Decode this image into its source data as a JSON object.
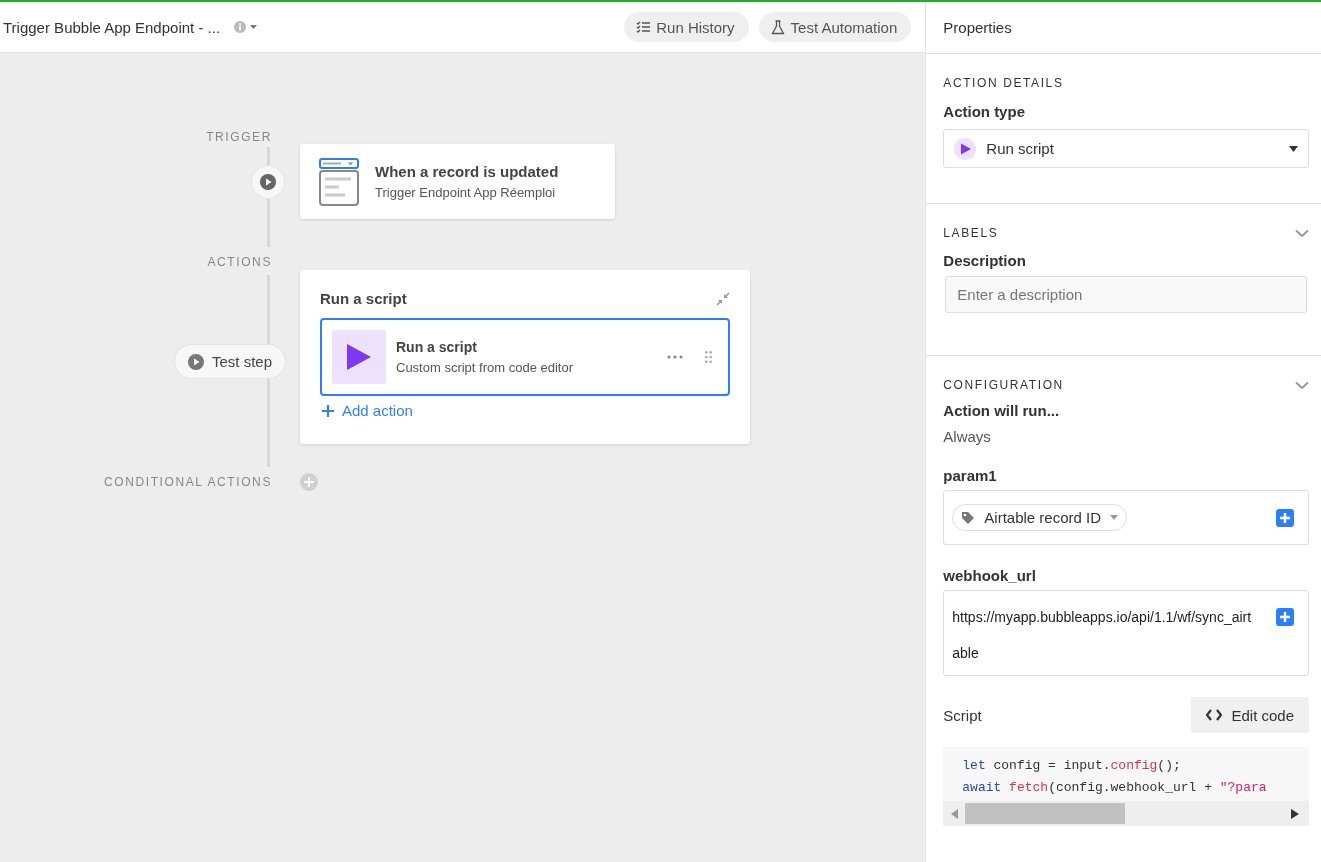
{
  "header": {
    "title": "Trigger Bubble App Endpoint - ...",
    "buttons": [
      {
        "label": "Run History",
        "kind": "history"
      },
      {
        "label": "Test Automation",
        "kind": "test"
      }
    ]
  },
  "flow": {
    "trigger_label": "TRIGGER",
    "trigger": {
      "title": "When a record is updated",
      "subtitle": "Trigger Endpoint App Réemploi"
    },
    "actions_label": "ACTIONS",
    "test_step": "Test step",
    "group": {
      "title": "Run a script",
      "actions": [
        {
          "title": "Run a script",
          "subtitle": "Custom script from code editor",
          "selected": true
        }
      ],
      "add_action": "Add action"
    },
    "conditional_label": "CONDITIONAL ACTIONS"
  },
  "properties": {
    "title": "Properties",
    "action_details": {
      "heading": "ACTION DETAILS",
      "label": "Action type",
      "value": "Run script"
    },
    "labels": {
      "heading": "LABELS",
      "label": "Description",
      "placeholder": "Enter a description"
    },
    "configuration": {
      "heading": "CONFIGURATION",
      "run_label": "Action will run...",
      "run_value": "Always",
      "inputs": [
        {
          "label": "param1",
          "kind": "token",
          "value": "Airtable record ID"
        },
        {
          "label": "webhook_url",
          "kind": "text",
          "value": "https://myapp.bubbleapps.io/api/1.1/wf/sync_airtable"
        }
      ],
      "script": {
        "label": "Script",
        "button": "Edit code",
        "lines": [
          [
            {
              "kind": "keyword",
              "text": "let"
            },
            {
              "kind": "plain",
              "text": " config = input."
            },
            {
              "kind": "call",
              "text": "config"
            },
            {
              "kind": "plain",
              "text": "();"
            }
          ],
          [
            {
              "kind": "keyword",
              "text": "await"
            },
            {
              "kind": "call",
              "text": " fetch"
            },
            {
              "kind": "plain",
              "text": "(config.webhook_url + "
            },
            {
              "kind": "string",
              "text": "\"?para"
            }
          ]
        ]
      }
    }
  }
}
